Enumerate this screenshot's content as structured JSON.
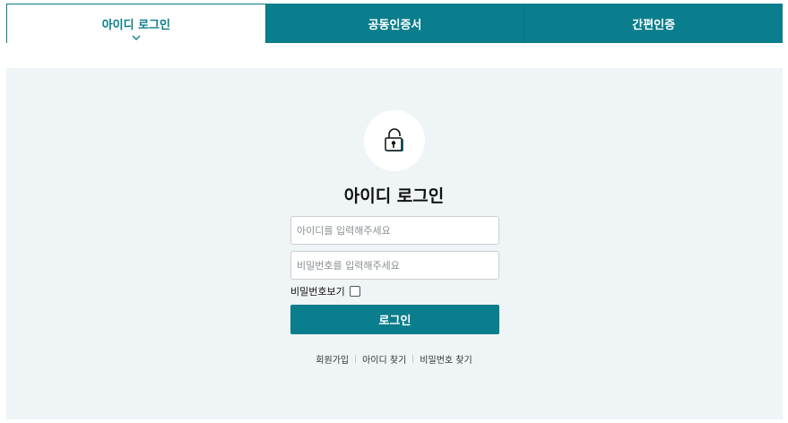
{
  "tabs": [
    {
      "label": "아이디 로그인",
      "active": true
    },
    {
      "label": "공동인증서",
      "active": false
    },
    {
      "label": "간편인증",
      "active": false
    }
  ],
  "login": {
    "title": "아이디 로그인",
    "id_placeholder": "아이디를 입력해주세요",
    "id_value": "",
    "pw_placeholder": "비밀번호를 입력해주세요",
    "pw_value": "",
    "show_password_label": "비밀번호보기",
    "show_password_checked": false,
    "submit_label": "로그인"
  },
  "links": {
    "signup": "회원가입",
    "find_id": "아이디 찾기",
    "find_pw": "비밀번호 찾기"
  },
  "colors": {
    "accent": "#0a7e8c",
    "panel_bg": "#eff4f6",
    "lock_icon": "#0a7e8c"
  },
  "icons": {
    "active_tab_indicator": "chevron-down-icon",
    "hero": "lock-icon"
  }
}
